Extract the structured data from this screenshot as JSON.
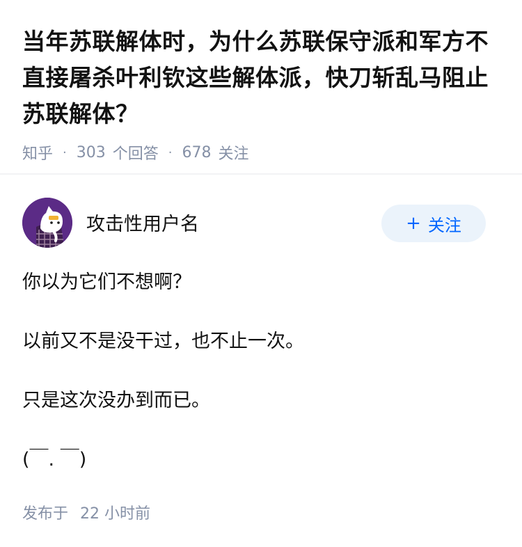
{
  "question": {
    "title": "当年苏联解体时，为什么苏联保守派和军方不直接屠杀叶利钦这些解体派，快刀斩乱马阻止苏联解体？",
    "source": "知乎",
    "answer_count": "303",
    "answer_label": "个回答",
    "follow_count": "678",
    "follow_label": "关注"
  },
  "author": {
    "name": "攻击性用户名",
    "follow_button": "关注",
    "avatar_icon": "cartoon-avatar-icon",
    "avatar_bg": "#5b2b86"
  },
  "answer": {
    "paragraphs": [
      "你以为它们不想啊？",
      "以前又不是没干过，也不止一次。",
      "只是这次没办到而已。",
      "(￣. ￣)"
    ]
  },
  "footer": {
    "published_label": "发布于",
    "time": "22 小时前"
  },
  "colors": {
    "text": "#121212",
    "meta": "#8590a6",
    "accent": "#0066ff",
    "button_bg": "#ebf3fb"
  }
}
